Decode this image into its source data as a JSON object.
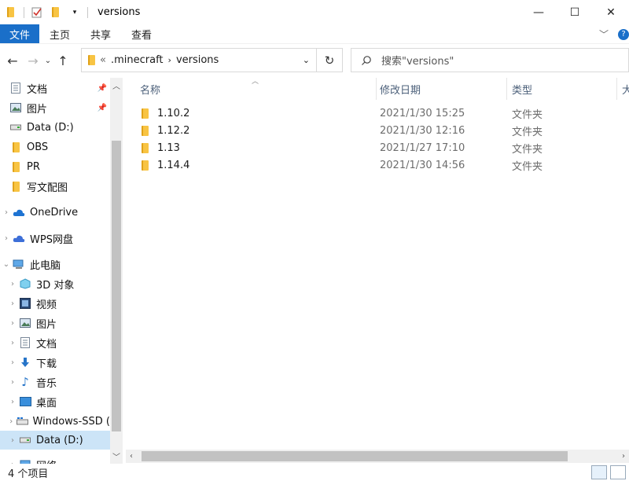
{
  "window": {
    "title": "versions"
  },
  "ribbon": {
    "tabs": [
      "文件",
      "主页",
      "共享",
      "查看"
    ]
  },
  "address": {
    "overflow": "«",
    "crumbs": [
      ".minecraft",
      "versions"
    ]
  },
  "search": {
    "placeholder": "搜索\"versions\""
  },
  "nav": {
    "items": [
      {
        "label": "文档",
        "icon": "documents-icon",
        "pinned": true
      },
      {
        "label": "图片",
        "icon": "pictures-icon",
        "pinned": true
      },
      {
        "label": "Data (D:)",
        "icon": "drive-icon"
      },
      {
        "label": "OBS",
        "icon": "folder-icon"
      },
      {
        "label": "PR",
        "icon": "folder-icon"
      },
      {
        "label": "写文配图",
        "icon": "folder-icon"
      },
      {
        "label": "OneDrive",
        "icon": "cloud-icon"
      },
      {
        "label": "WPS网盘",
        "icon": "cloud-icon"
      },
      {
        "label": "此电脑",
        "icon": "computer-icon"
      },
      {
        "label": "3D 对象",
        "icon": "3d-objects-icon"
      },
      {
        "label": "视频",
        "icon": "videos-icon"
      },
      {
        "label": "图片",
        "icon": "pictures-icon"
      },
      {
        "label": "文档",
        "icon": "documents-icon"
      },
      {
        "label": "下载",
        "icon": "downloads-icon"
      },
      {
        "label": "音乐",
        "icon": "music-icon"
      },
      {
        "label": "桌面",
        "icon": "desktop-icon"
      },
      {
        "label": "Windows-SSD (",
        "icon": "windows-drive-icon"
      },
      {
        "label": "Data (D:)",
        "icon": "drive-icon"
      },
      {
        "label": "网络",
        "icon": "network-icon"
      }
    ]
  },
  "columns": {
    "name": "名称",
    "date": "修改日期",
    "type": "类型",
    "size": "大"
  },
  "files": [
    {
      "name": "1.10.2",
      "date": "2021/1/30 15:25",
      "type": "文件夹"
    },
    {
      "name": "1.12.2",
      "date": "2021/1/30 12:16",
      "type": "文件夹"
    },
    {
      "name": "1.13",
      "date": "2021/1/27 17:10",
      "type": "文件夹"
    },
    {
      "name": "1.14.4",
      "date": "2021/1/30 14:56",
      "type": "文件夹"
    }
  ],
  "status": {
    "count": "4 个项目"
  }
}
